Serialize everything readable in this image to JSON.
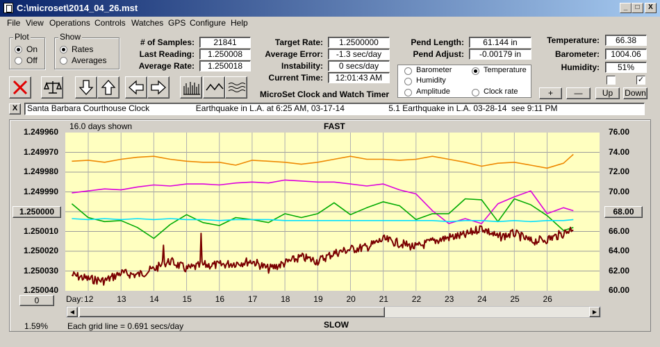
{
  "window": {
    "title": "C:\\microset\\2014_04_26.mst",
    "minimize": "_",
    "maximize": "□",
    "close": "X"
  },
  "menu": [
    "File",
    "View",
    "Operations",
    "Controls",
    "Watches",
    "GPS",
    "Configure",
    "Help"
  ],
  "plot_group": {
    "title": "Plot",
    "on": "On",
    "off": "Off",
    "selected": "On"
  },
  "show_group": {
    "title": "Show",
    "rates": "Rates",
    "averages": "Averages",
    "selected": "Rates"
  },
  "stats": {
    "samples_label": "# of Samples:",
    "samples": "21841",
    "last_label": "Last Reading:",
    "last": "1.250008",
    "avg_label": "Average Rate:",
    "avg": "1.250018",
    "target_label": "Target Rate:",
    "target": "1.2500000",
    "avgerr_label": "Average Error:",
    "avgerr": "-1.3 sec/day",
    "instab_label": "Instability:",
    "instab": "0 secs/day",
    "time_label": "Current Time:",
    "time": "12:01:43 AM",
    "pendlen_label": "Pend Length:",
    "pendlen": "61.144 in",
    "pendadj_label": "Pend Adjust:",
    "pendadj": "-0.00179 in",
    "temp_label": "Temperature:",
    "temp": "66.38",
    "baro_label": "Barometer:",
    "baro": "1004.06",
    "hum_label": "Humidity:",
    "hum": "51%"
  },
  "app_caption": "MicroSet Clock and Watch Timer",
  "sensor_select": {
    "barometer": "Barometer",
    "temperature": "Temperature",
    "humidity": "Humidity",
    "amplitude": "Amplitude",
    "clock_rate": "Clock rate",
    "selected": "Temperature"
  },
  "scale_buttons": {
    "plus": "+",
    "minus": "—",
    "up": "Up",
    "down": "Down"
  },
  "checks": {
    "left": "",
    "right": "✓"
  },
  "toolbar_icons": [
    "delete-icon",
    "balance-scale-icon",
    "arrow-down-icon",
    "arrow-up-icon",
    "arrow-left-icon",
    "arrow-right-icon",
    "histogram-icon",
    "wave-icon",
    "multi-wave-icon"
  ],
  "notes_bar": {
    "close": "X",
    "text": "Santa Barbara Courthouse Clock                    Earthquake in L.A. at 6:25 AM, 03-17-14                   5.1 Earthquake in L.A. 03-28-14  see 9:11 PM"
  },
  "graph": {
    "days_shown": "16.0 days shown",
    "top_label": "FAST",
    "bottom_label": "SLOW",
    "left_ref_button": "1.250000",
    "right_ref_button": "68.00",
    "bottom_left_button": "0",
    "day_label": "Day:",
    "zoom_pct": "1.59%",
    "grid_note": "Each grid line = 0.691 secs/day"
  },
  "colors": {
    "plot_bg": "#ffffc0",
    "barometer": "#ee8800",
    "temperature": "#00aa00",
    "humidity": "#dd00dd",
    "amplitude": "#00e0ff",
    "clock_rate": "#7a0000"
  },
  "chart_data": {
    "type": "line",
    "title": "FAST",
    "x": [
      11.5,
      12,
      12.5,
      13,
      13.5,
      14,
      14.5,
      15,
      15.5,
      16,
      16.5,
      17,
      17.5,
      18,
      18.5,
      19,
      19.5,
      20,
      20.5,
      21,
      21.5,
      22,
      22.5,
      23,
      23.5,
      24,
      24.5,
      25,
      25.5,
      26,
      26.5,
      26.8
    ],
    "xlim": [
      11.3,
      27.6
    ],
    "x_ticks": [
      "12",
      "13",
      "14",
      "15",
      "16",
      "17",
      "18",
      "19",
      "20",
      "21",
      "22",
      "23",
      "24",
      "25",
      "26"
    ],
    "y_left_ticks": [
      "1.249960",
      "1.249970",
      "1.249980",
      "1.249990",
      "1.250000",
      "1.250010",
      "1.250020",
      "1.250030",
      "1.250040"
    ],
    "y_left_lim": [
      1.24996,
      1.25004
    ],
    "y_right_ticks": [
      "76.00",
      "74.00",
      "72.00",
      "70.00",
      "68.00",
      "66.00",
      "64.00",
      "62.00",
      "60.00"
    ],
    "y_right_lim": [
      60,
      76
    ],
    "series": [
      {
        "name": "Barometer",
        "axis": "right",
        "values": [
          73.1,
          73.2,
          73.0,
          73.3,
          73.5,
          73.6,
          73.3,
          73.1,
          73.0,
          73.0,
          72.7,
          73.2,
          73.1,
          73.0,
          72.8,
          73.0,
          73.3,
          73.6,
          73.3,
          73.3,
          73.2,
          73.3,
          73.6,
          73.3,
          73.0,
          72.6,
          72.9,
          73.0,
          72.7,
          72.4,
          72.9,
          73.8
        ]
      },
      {
        "name": "Humidity",
        "axis": "right",
        "values": [
          69.9,
          70.1,
          70.3,
          70.2,
          70.5,
          70.7,
          70.6,
          70.8,
          70.8,
          70.7,
          70.9,
          71.0,
          70.9,
          71.2,
          71.1,
          71.0,
          71.0,
          70.8,
          70.6,
          70.8,
          70.2,
          69.8,
          68.1,
          66.8,
          67.3,
          66.8,
          68.8,
          69.5,
          70.1,
          67.8,
          68.4,
          68.1
        ]
      },
      {
        "name": "Temperature",
        "axis": "right",
        "values": [
          68.8,
          67.4,
          67.0,
          67.1,
          66.4,
          65.3,
          66.7,
          67.7,
          66.9,
          66.6,
          67.4,
          67.2,
          66.9,
          67.8,
          67.4,
          67.8,
          68.9,
          67.7,
          68.4,
          69.0,
          68.6,
          67.2,
          67.8,
          67.8,
          69.3,
          69.2,
          67.0,
          69.3,
          68.7,
          67.6,
          66.1,
          66.4
        ]
      },
      {
        "name": "Amplitude",
        "axis": "right",
        "values": [
          67.3,
          67.2,
          67.3,
          67.2,
          67.3,
          67.2,
          67.3,
          67.2,
          67.2,
          67.1,
          67.2,
          67.2,
          67.2,
          67.1,
          67.1,
          67.1,
          67.1,
          67.1,
          67.1,
          67.1,
          67.1,
          67.1,
          67.1,
          67.0,
          67.1,
          67.1,
          67.0,
          67.1,
          67.0,
          67.1,
          67.1,
          67.2
        ]
      },
      {
        "name": "Clock rate",
        "axis": "left",
        "values": [
          1.250032,
          1.250034,
          1.250035,
          1.250031,
          1.250032,
          1.250029,
          1.250025,
          1.250029,
          1.250027,
          1.250027,
          1.250026,
          1.250025,
          1.250029,
          1.250026,
          1.250023,
          1.250025,
          1.250021,
          1.250019,
          1.250018,
          1.250014,
          1.250016,
          1.250018,
          1.250015,
          1.250013,
          1.250012,
          1.250008,
          1.250013,
          1.250011,
          1.250015,
          1.250014,
          1.250011,
          1.250008
        ]
      }
    ],
    "spikes": [
      {
        "x": 14.3,
        "series": "Clock rate",
        "value": 1.250017
      },
      {
        "x": 15.45,
        "series": "Clock rate",
        "value": 1.250011
      }
    ],
    "grid": true,
    "xlabel": "Day:"
  }
}
